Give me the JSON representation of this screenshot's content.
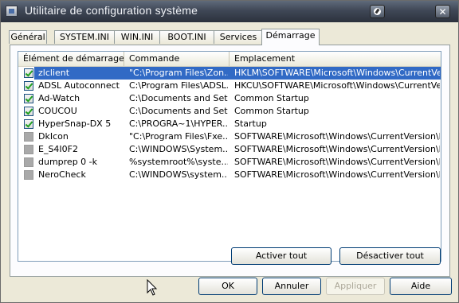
{
  "window": {
    "title": "Utilitaire de configuration système"
  },
  "tabs": [
    {
      "label": "Général"
    },
    {
      "label": "SYSTEM.INI"
    },
    {
      "label": "WIN.INI"
    },
    {
      "label": "BOOT.INI"
    },
    {
      "label": "Services"
    },
    {
      "label": "Démarrage",
      "active": true
    }
  ],
  "list": {
    "columns": [
      "Élément de démarrage",
      "Commande",
      "Emplacement"
    ],
    "rows": [
      {
        "checked": true,
        "item": "zlclient",
        "command": "\"C:\\Program Files\\Zon...",
        "location": "HKLM\\SOFTWARE\\Microsoft\\Windows\\CurrentVer...",
        "selected": true
      },
      {
        "checked": true,
        "item": "ADSL Autoconnect",
        "command": "C:\\Program Files\\ADSL...",
        "location": "HKCU\\SOFTWARE\\Microsoft\\Windows\\CurrentVer..."
      },
      {
        "checked": true,
        "item": "Ad-Watch",
        "command": "C:\\Documents and Set...",
        "location": "Common Startup"
      },
      {
        "checked": true,
        "item": "COUCOU",
        "command": "C:\\Documents and Set...",
        "location": "Common Startup"
      },
      {
        "checked": true,
        "item": "HyperSnap-DX 5",
        "command": "C:\\PROGRA~1\\HYPER...",
        "location": "Startup"
      },
      {
        "checked": false,
        "item": "DkIcon",
        "command": "\"C:\\Program Files\\Fxe...",
        "location": "SOFTWARE\\Microsoft\\Windows\\CurrentVersion\\Run"
      },
      {
        "checked": false,
        "item": "E_S4I0F2",
        "command": "C:\\WINDOWS\\System...",
        "location": "SOFTWARE\\Microsoft\\Windows\\CurrentVersion\\Run"
      },
      {
        "checked": false,
        "item": "dumprep 0 -k",
        "command": "%systemroot%\\syste...",
        "location": "SOFTWARE\\Microsoft\\Windows\\CurrentVersion\\Run"
      },
      {
        "checked": false,
        "item": "NeroCheck",
        "command": "C:\\WINDOWS\\system...",
        "location": "SOFTWARE\\Microsoft\\Windows\\CurrentVersion\\Run"
      }
    ]
  },
  "buttons": {
    "enable_all": "Activer tout",
    "disable_all": "Désactiver tout",
    "ok": "OK",
    "cancel": "Annuler",
    "apply": "Appliquer",
    "help": "Aide"
  },
  "colors": {
    "selection": "#316ac5",
    "titlebar": "#3f4756",
    "dialog_bg": "#ece9d8"
  }
}
